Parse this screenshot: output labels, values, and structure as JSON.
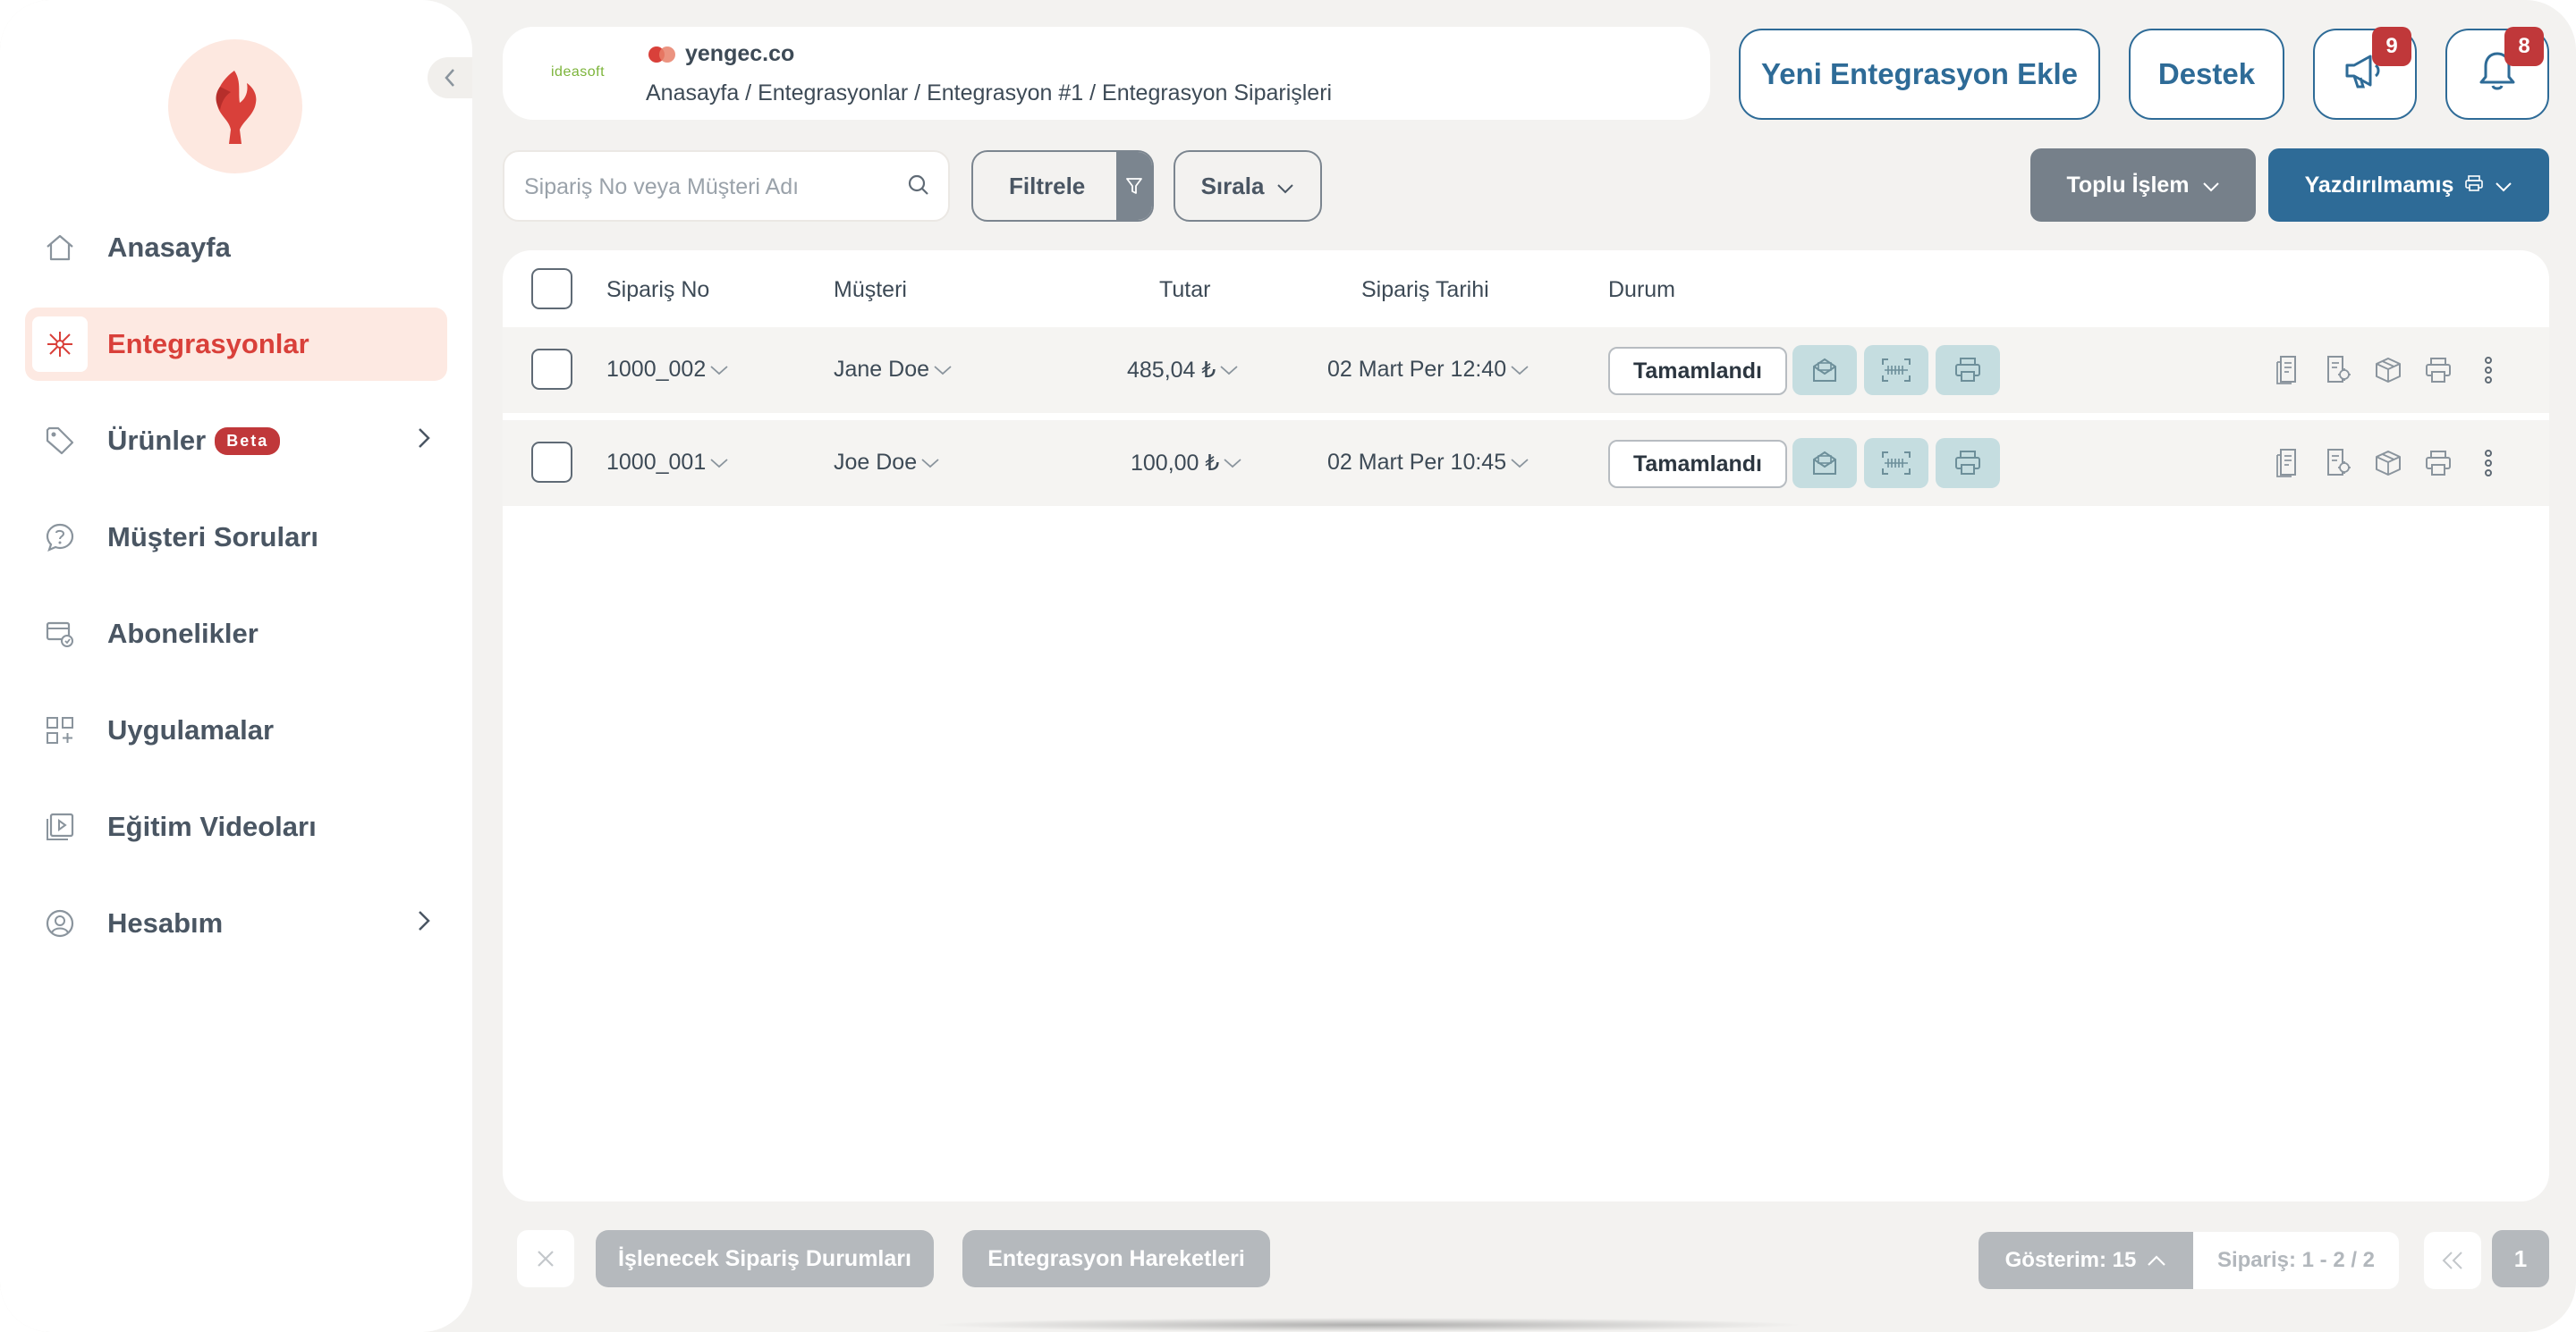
{
  "sidebar": {
    "items": [
      {
        "label": "Anasayfa",
        "icon": "home-icon"
      },
      {
        "label": "Entegrasyonlar",
        "icon": "integration-icon",
        "active": true
      },
      {
        "label": "Ürünler",
        "icon": "tag-icon",
        "badge": "Beta",
        "has_submenu": true
      },
      {
        "label": "Müşteri Soruları",
        "icon": "question-bubble-icon"
      },
      {
        "label": "Abonelikler",
        "icon": "subscription-icon"
      },
      {
        "label": "Uygulamalar",
        "icon": "apps-grid-icon"
      },
      {
        "label": "Eğitim Videoları",
        "icon": "video-icon"
      },
      {
        "label": "Hesabım",
        "icon": "user-icon",
        "has_submenu": true
      }
    ]
  },
  "header": {
    "platform_logo_a": "ideasoft",
    "store_name": "yengec.co",
    "breadcrumb": "Anasayfa / Entegrasyonlar / Entegrasyon #1 / Entegrasyon Siparişleri",
    "add_integration_label": "Yeni Entegrasyon Ekle",
    "support_label": "Destek",
    "announcements_count": "9",
    "notifications_count": "8"
  },
  "toolbar": {
    "search_placeholder": "Sipariş No veya Müşteri Adı",
    "filter_label": "Filtrele",
    "sort_label": "Sırala",
    "bulk_label": "Toplu İşlem",
    "print_filter_label": "Yazdırılmamış"
  },
  "table": {
    "columns": [
      "Sipariş No",
      "Müşteri",
      "Tutar",
      "Sipariş Tarihi",
      "Durum"
    ],
    "rows": [
      {
        "order_no": "1000_002",
        "customer": "Jane Doe",
        "amount": "485,04 ₺",
        "date": "02 Mart Per 12:40",
        "status": "Tamamlandı"
      },
      {
        "order_no": "1000_001",
        "customer": "Joe Doe",
        "amount": "100,00 ₺",
        "date": "02 Mart Per 10:45",
        "status": "Tamamlandı"
      }
    ]
  },
  "footer": {
    "order_statuses_label": "İşlenecek Sipariş Durumları",
    "integration_moves_label": "Entegrasyon Hareketleri",
    "show_count_label": "Gösterim: 15",
    "order_range_label": "Sipariş: 1 - 2 / 2",
    "current_page": "1"
  },
  "colors": {
    "accent_red": "#d9403a",
    "primary_blue": "#2e6b97",
    "badge_red": "#c0383a",
    "action_teal": "#c5dde0"
  }
}
